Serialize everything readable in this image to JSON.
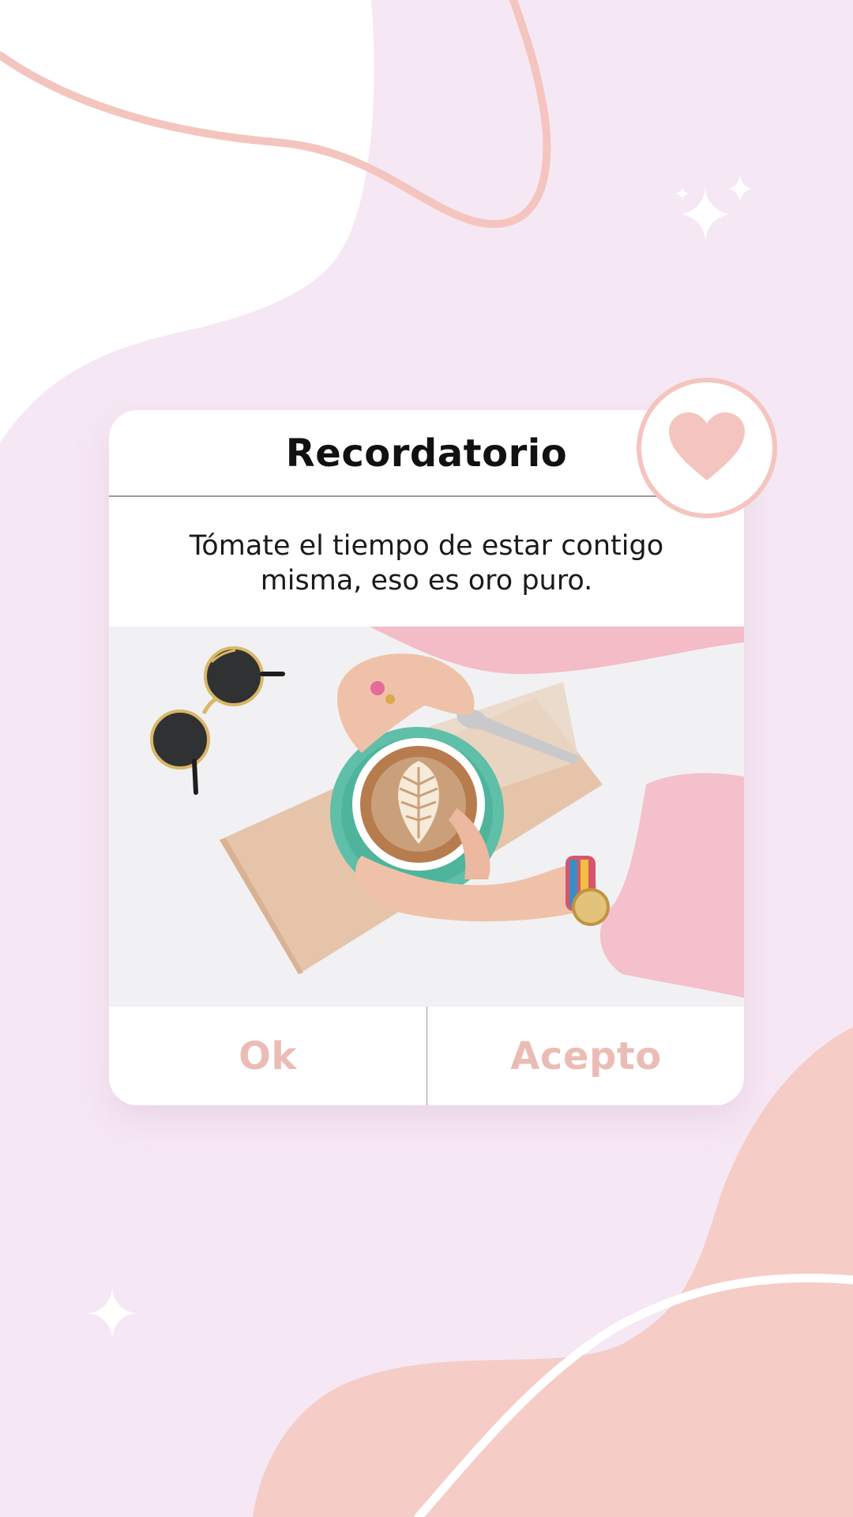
{
  "dialog": {
    "title": "Recordatorio",
    "message": "Tómate el tiempo de estar contigo misma, eso es oro puro.",
    "buttons": {
      "ok": "Ok",
      "accept": "Acepto"
    }
  },
  "icons": {
    "badge": "heart-icon",
    "decor": "sparkle-icon"
  },
  "colors": {
    "background": "#f6e7f4",
    "accent": "#f4c5be",
    "button_text": "#ebbcb6",
    "card": "#ffffff"
  }
}
